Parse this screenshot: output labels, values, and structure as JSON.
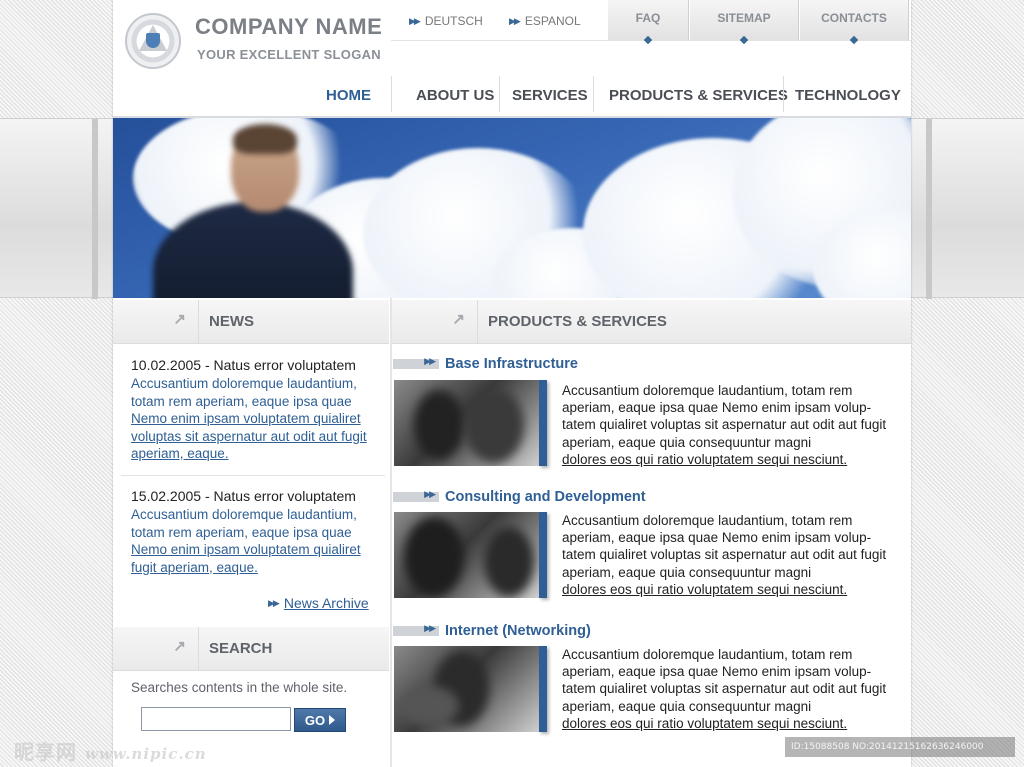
{
  "header": {
    "company_name": "COMPANY NAME",
    "slogan": "YOUR EXCELLENT SLOGAN",
    "languages": [
      "DEUTSCH",
      "ESPANOL"
    ],
    "top_links": [
      "FAQ",
      "SITEMAP",
      "CONTACTS"
    ],
    "nav": [
      "HOME",
      "ABOUT US",
      "SERVICES",
      "PRODUCTS & SERVICES",
      "TECHNOLOGY"
    ],
    "active_nav": "HOME"
  },
  "news": {
    "heading": "NEWS",
    "items": [
      {
        "date_line": "10.02.2005 - Natus error voluptatem",
        "text": "Accusantium doloremque laudantium, totam rem aperiam, eaque ipsa quae",
        "link": "Nemo enim ipsam voluptatem quialiret voluptas sit aspernatur aut odit aut fugit aperiam, eaque."
      },
      {
        "date_line": "15.02.2005 - Natus error voluptatem",
        "text": "Accusantium doloremque laudantium, totam rem aperiam, eaque ipsa quae",
        "link": "Nemo enim ipsam voluptatem quialiret fugit aperiam, eaque."
      }
    ],
    "archive_label": "News Archive"
  },
  "search": {
    "heading": "SEARCH",
    "hint": "Searches contents in the whole site.",
    "input_value": "",
    "button_label": "GO"
  },
  "products": {
    "heading": "PRODUCTS & SERVICES",
    "items": [
      {
        "title": "Base Infrastructure",
        "text": "Accusantium doloremque laudantium, totam rem aperiam, eaque ipsa quae  Nemo enim ipsam volup-tatem quialiret voluptas sit aspernatur aut odit aut fugit aperiam, eaque quia consequuntur magni",
        "link": "dolores eos qui ratio voluptatem sequi nesciunt."
      },
      {
        "title": "Consulting and Development",
        "text": "Accusantium doloremque laudantium, totam rem aperiam, eaque ipsa quae  Nemo enim ipsam volup-tatem quialiret voluptas sit aspernatur aut odit aut fugit aperiam, eaque quia consequuntur magni",
        "link": "dolores eos qui ratio voluptatem sequi nesciunt."
      },
      {
        "title": "Internet (Networking)",
        "text": "Accusantium doloremque laudantium, totam rem aperiam, eaque ipsa quae  Nemo enim ipsam volup-tatem quialiret voluptas sit aspernatur aut odit aut fugit aperiam, eaque quia consequuntur magni",
        "link": "dolores eos qui ratio voluptatem sequi nesciunt."
      }
    ]
  },
  "overlay": {
    "watermark_cn": "昵享网",
    "watermark_url": "www.nipic.cn",
    "id_text": "ID:15088508 NO:20141215162636246000"
  },
  "colors": {
    "accent": "#2f5f94",
    "heading_gray": "#5f636a",
    "banner_sky": "#3767b5"
  }
}
